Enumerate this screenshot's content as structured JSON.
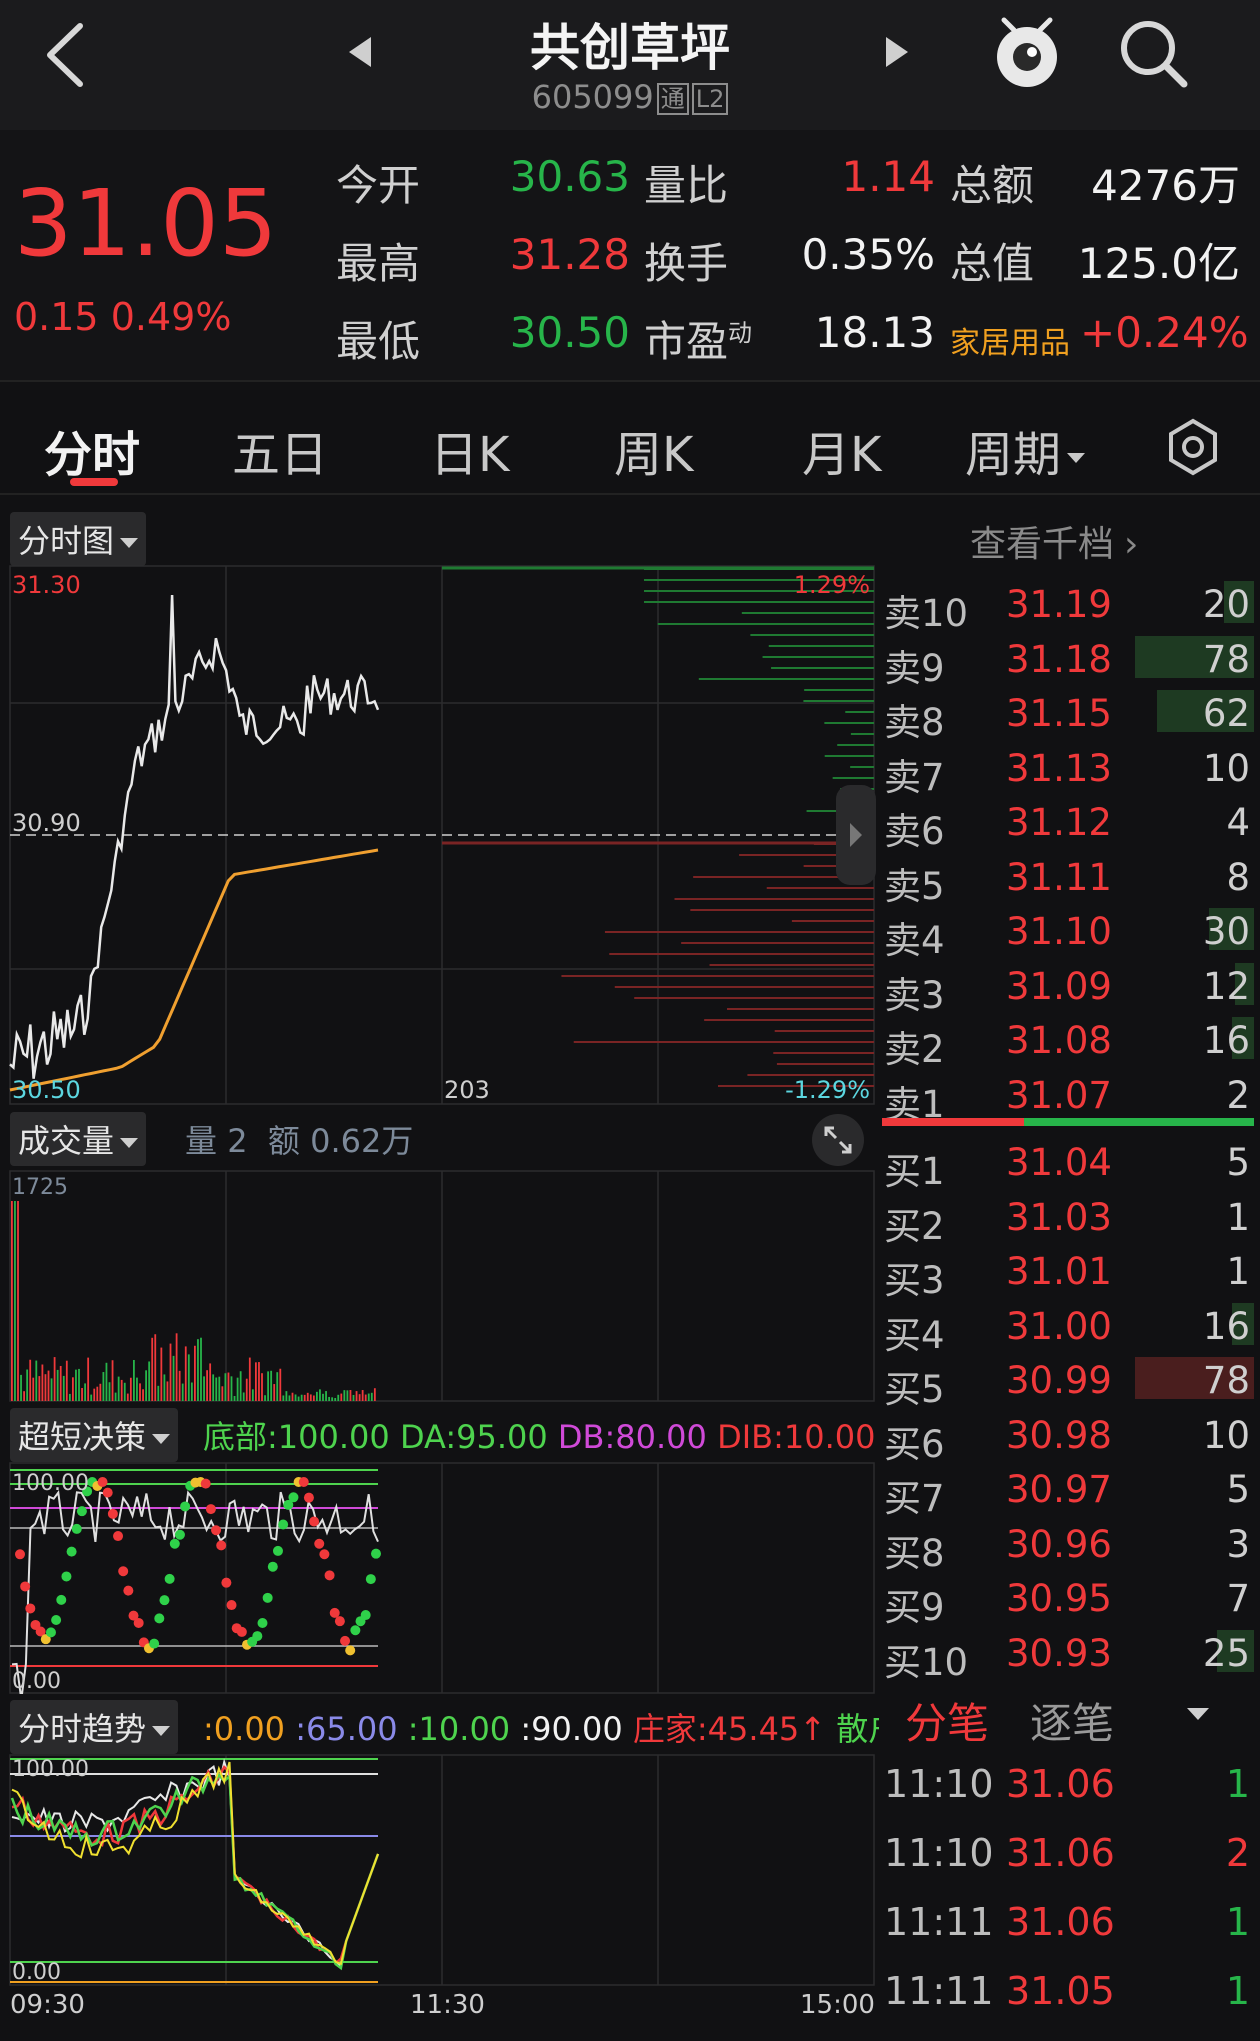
{
  "header": {
    "stock_name": "共创草坪",
    "stock_code": "605099",
    "badge_tong": "通",
    "badge_l2": "L2"
  },
  "quote": {
    "price": "31.05",
    "change": "0.15",
    "change_pct": "0.49%",
    "open_label": "今开",
    "open": "30.63",
    "high_label": "最高",
    "high": "31.28",
    "low_label": "最低",
    "low": "30.50",
    "vol_ratio_label": "量比",
    "vol_ratio": "1.14",
    "turnover_label": "换手",
    "turnover": "0.35%",
    "pe_label": "市盈",
    "pe_sup": "动",
    "pe": "18.13",
    "amount_label": "总额",
    "amount": "4276万",
    "mcap_label": "总值",
    "mcap": "125.0亿",
    "sector": "家居用品",
    "sector_change": "+0.24%"
  },
  "tabs": [
    "分时",
    "五日",
    "日K",
    "周K",
    "月K",
    "周期"
  ],
  "intraday": {
    "panel_label": "分时图",
    "view_depth": "查看千档",
    "y_top": "31.30",
    "y_mid": "30.90",
    "y_bottom": "30.50",
    "pct_top": "1.29%",
    "pct_bottom": "-1.29%",
    "x_mid_label": "203",
    "expand_icon": "expand-icon"
  },
  "volume": {
    "panel_label": "成交量",
    "vol_label": "量",
    "vol_value": "2",
    "amt_label": "额",
    "amt_value": "0.62万",
    "y_top": "1725"
  },
  "decision": {
    "panel_label": "超短决策",
    "bottom": "底部:100.00",
    "da": "DA:95.00",
    "db": "DB:80.00",
    "dib": "DIB:10.00",
    "y_top": "100.00",
    "y_bottom": "0.00"
  },
  "trend": {
    "panel_label": "分时趋势",
    "v1": ":0.00",
    "v2": ":65.00",
    "v3": ":10.00",
    "v4": ":90.00",
    "dealer": "庄家:45.45",
    "retail": "散户",
    "y_top": "100.00",
    "y_bottom": "0.00",
    "x_start": "09:30",
    "x_mid": "11:30",
    "x_end": "15:00"
  },
  "order_book": {
    "sells": [
      {
        "label": "卖10",
        "price": "31.19",
        "qty": "20",
        "bar": 0.08
      },
      {
        "label": "卖9",
        "price": "31.18",
        "qty": "78",
        "bar": 0.32
      },
      {
        "label": "卖8",
        "price": "31.15",
        "qty": "62",
        "bar": 0.26
      },
      {
        "label": "卖7",
        "price": "31.13",
        "qty": "10",
        "bar": 0.0
      },
      {
        "label": "卖6",
        "price": "31.12",
        "qty": "4",
        "bar": 0.0
      },
      {
        "label": "卖5",
        "price": "31.11",
        "qty": "8",
        "bar": 0.0
      },
      {
        "label": "卖4",
        "price": "31.10",
        "qty": "30",
        "bar": 0.12
      },
      {
        "label": "卖3",
        "price": "31.09",
        "qty": "12",
        "bar": 0.05
      },
      {
        "label": "卖2",
        "price": "31.08",
        "qty": "16",
        "bar": 0.06
      },
      {
        "label": "卖1",
        "price": "31.07",
        "qty": "2",
        "bar": 0.0
      }
    ],
    "buys": [
      {
        "label": "买1",
        "price": "31.04",
        "qty": "5",
        "bar": 0.0
      },
      {
        "label": "买2",
        "price": "31.03",
        "qty": "1",
        "bar": 0.0
      },
      {
        "label": "买3",
        "price": "31.01",
        "qty": "1",
        "bar": 0.0
      },
      {
        "label": "买4",
        "price": "31.00",
        "qty": "16",
        "bar": 0.06
      },
      {
        "label": "买5",
        "price": "30.99",
        "qty": "78",
        "bar": 0.32
      },
      {
        "label": "买6",
        "price": "30.98",
        "qty": "10",
        "bar": 0.0
      },
      {
        "label": "买7",
        "price": "30.97",
        "qty": "5",
        "bar": 0.0
      },
      {
        "label": "买8",
        "price": "30.96",
        "qty": "3",
        "bar": 0.0
      },
      {
        "label": "买9",
        "price": "30.95",
        "qty": "7",
        "bar": 0.0
      },
      {
        "label": "买10",
        "price": "30.93",
        "qty": "25",
        "bar": 0.1
      }
    ]
  },
  "ticks": {
    "tab_fenbi": "分笔",
    "tab_zhubi": "逐笔",
    "rows": [
      {
        "time": "11:10",
        "price": "31.06",
        "qty": "1"
      },
      {
        "time": "11:10",
        "price": "31.06",
        "qty": "2"
      },
      {
        "time": "11:11",
        "price": "31.06",
        "qty": "1"
      },
      {
        "time": "11:11",
        "price": "31.05",
        "qty": "1"
      }
    ]
  },
  "colors": {
    "up": "#f0393b",
    "down": "#27b54a",
    "avg_line": "#f0a020",
    "background": "#111113"
  }
}
